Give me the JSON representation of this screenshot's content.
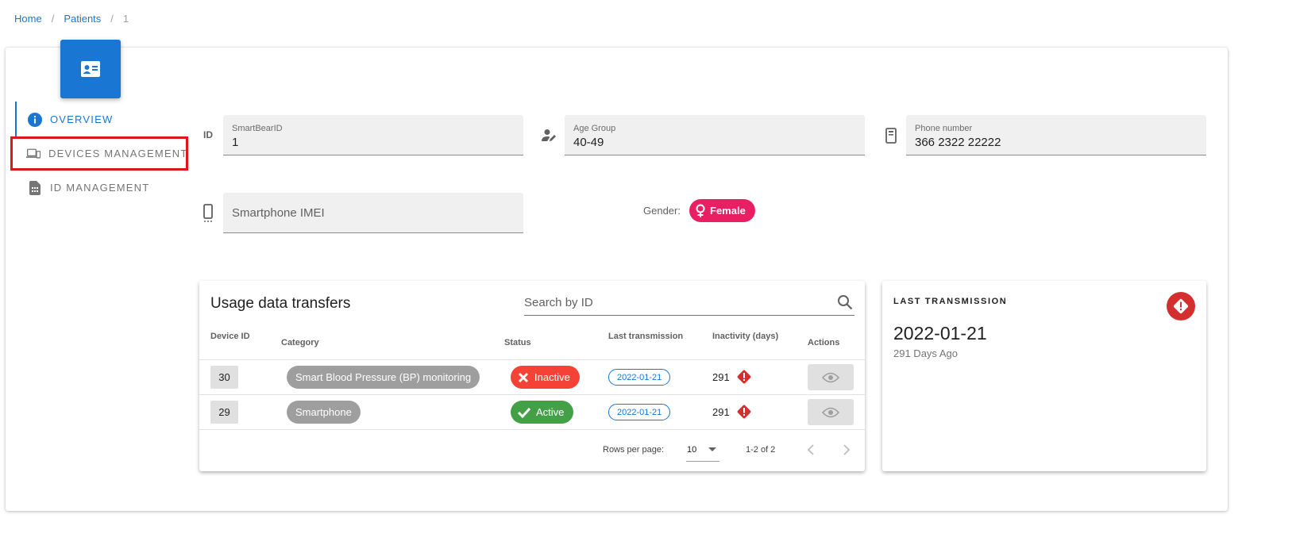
{
  "breadcrumb": {
    "home": "Home",
    "patients": "Patients",
    "current": "1"
  },
  "nav": {
    "overview": "Overview",
    "devices": "Devices Management",
    "id_management": "ID Management"
  },
  "fields": {
    "id_icon_text": "ID",
    "smartbear_label": "SmartBearID",
    "smartbear_value": "1",
    "age_label": "Age Group",
    "age_value": "40-49",
    "phone_label": "Phone number",
    "phone_value": "366 2322 22222",
    "imei_placeholder": "Smartphone IMEI"
  },
  "gender": {
    "label": "Gender:",
    "value": "Female"
  },
  "table": {
    "title": "Usage data transfers",
    "search_placeholder": "Search by ID",
    "headers": {
      "device_id": "Device ID",
      "category": "Category",
      "status": "Status",
      "last_transmission": "Last transmission",
      "inactivity": "Inactivity (days)",
      "actions": "Actions"
    },
    "rows": [
      {
        "device_id": "30",
        "category": "Smart Blood Pressure (BP) monitoring",
        "status": "Inactive",
        "last_transmission": "2022-01-21",
        "inactivity": "291"
      },
      {
        "device_id": "29",
        "category": "Smartphone",
        "status": "Active",
        "last_transmission": "2022-01-21",
        "inactivity": "291"
      }
    ],
    "pagination": {
      "rows_per_page_label": "Rows per page:",
      "rows_per_page": "10",
      "range": "1-2 of 2"
    }
  },
  "last_transmission": {
    "title": "LAST TRANSMISSION",
    "date": "2022-01-21",
    "ago": "291 Days Ago"
  },
  "colors": {
    "primary": "#1976d2",
    "highlight": "#e0161f",
    "female": "#e91e63",
    "inactive": "#f44336",
    "active": "#43a047",
    "warning": "#d32f2f"
  }
}
